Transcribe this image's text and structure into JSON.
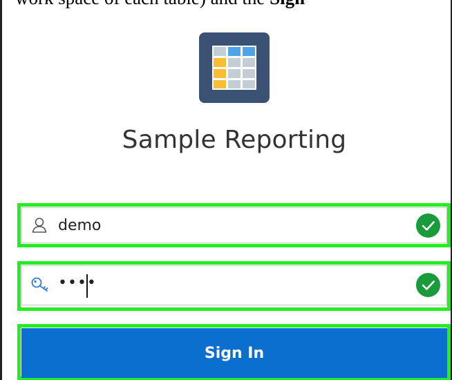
{
  "page": {
    "caption_fragment_regular": "work space of each table) and the ",
    "caption_fragment_bold": "Sign"
  },
  "app": {
    "title": "Sample Reporting",
    "logo_icon": "spreadsheet-grid-icon"
  },
  "login": {
    "username": {
      "value": "demo",
      "icon": "user-icon",
      "status_icon": "check-circle-icon"
    },
    "password": {
      "masked_value": "••••",
      "icon": "key-icon",
      "status_icon": "check-circle-icon"
    },
    "submit_label": "Sign In"
  },
  "colors": {
    "highlight": "#22ee22",
    "primary_button": "#0b6fd0",
    "logo_tile": "#3b5274",
    "success": "#1a9b3b"
  }
}
